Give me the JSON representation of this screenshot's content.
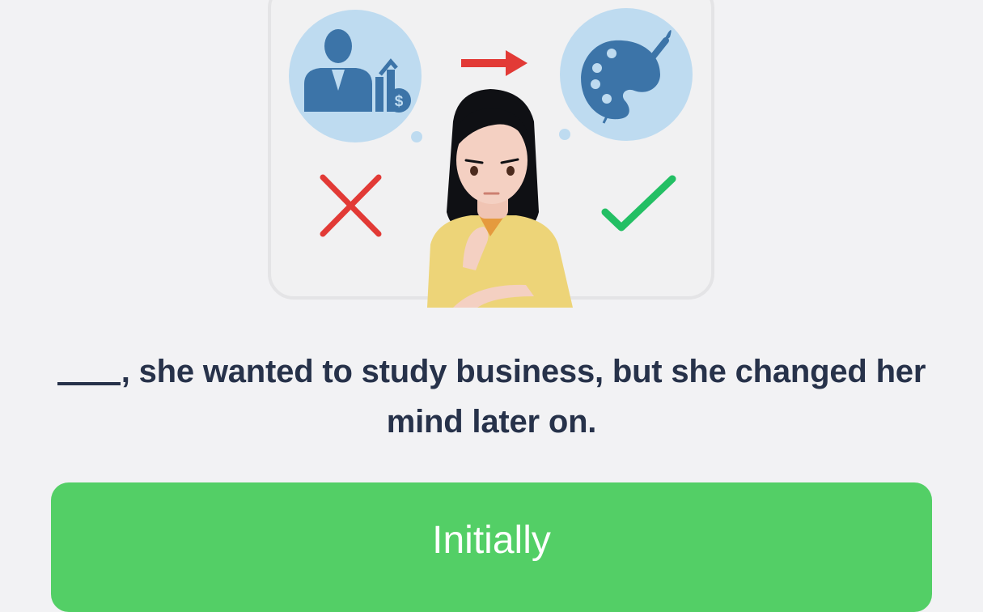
{
  "illustration": {
    "left_bubble_icon": "businessman-growth-chart-icon",
    "right_bubble_icon": "paint-palette-brush-icon",
    "arrow_icon": "right-arrow-icon",
    "cross_icon": "cross-mark-icon",
    "check_icon": "check-mark-icon",
    "colors": {
      "bubble": "#bedbf0",
      "icon_blue": "#3c74a8",
      "red": "#e23a36",
      "green": "#23bf64",
      "shirt": "#edd478"
    }
  },
  "question": {
    "text": ", she wanted to study business, but she changed her mind later on."
  },
  "answer": {
    "label": "Initially",
    "color": "#53cf66"
  }
}
